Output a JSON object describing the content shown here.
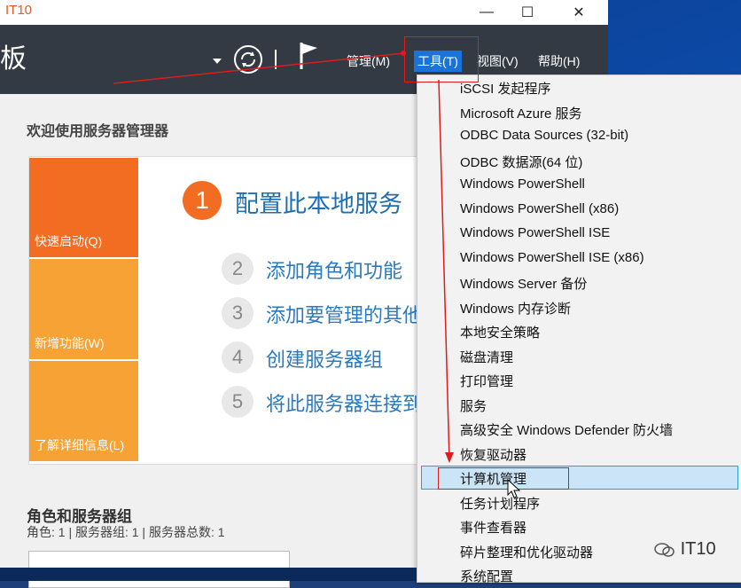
{
  "window": {
    "title": "IT10",
    "min_label": "—",
    "max_label": "☐",
    "close_label": "✕"
  },
  "toolbar": {
    "truncated_title": "板",
    "menus": [
      {
        "label": "管理(M)"
      },
      {
        "label": "工具(T)"
      },
      {
        "label": "视图(V)"
      },
      {
        "label": "帮助(H)"
      }
    ]
  },
  "welcome": {
    "title": "欢迎使用服务器管理器",
    "tiles": [
      {
        "label": "快速启动(Q)",
        "color": "#f26c22"
      },
      {
        "label": "新增功能(W)",
        "color": "#f7a234"
      },
      {
        "label": "了解详细信息(L)",
        "color": "#f7a234"
      }
    ],
    "steps": [
      {
        "num": "1",
        "text": "配置此本地服务"
      },
      {
        "num": "2",
        "text": "添加角色和功能"
      },
      {
        "num": "3",
        "text": "添加要管理的其他"
      },
      {
        "num": "4",
        "text": "创建服务器组"
      },
      {
        "num": "5",
        "text": "将此服务器连接到"
      }
    ]
  },
  "roles": {
    "title": "角色和服务器组",
    "subtitle": "角色: 1 | 服务器组: 1 | 服务器总数: 1"
  },
  "tools_menu": {
    "items": [
      "iSCSI 发起程序",
      "Microsoft Azure 服务",
      "ODBC Data Sources (32-bit)",
      "ODBC 数据源(64 位)",
      "Windows PowerShell",
      "Windows PowerShell (x86)",
      "Windows PowerShell ISE",
      "Windows PowerShell ISE (x86)",
      "Windows Server 备份",
      "Windows 内存诊断",
      "本地安全策略",
      "磁盘清理",
      "打印管理",
      "服务",
      "高级安全 Windows Defender 防火墙",
      "恢复驱动器",
      "计算机管理",
      "任务计划程序",
      "事件查看器",
      "碎片整理和优化驱动器",
      "系统配置"
    ],
    "selected": "计算机管理"
  },
  "watermark": {
    "text": "IT10"
  },
  "colors": {
    "accent": "#1a73d9",
    "annotation": "#e01b1b",
    "toolbar": "#333a44"
  }
}
